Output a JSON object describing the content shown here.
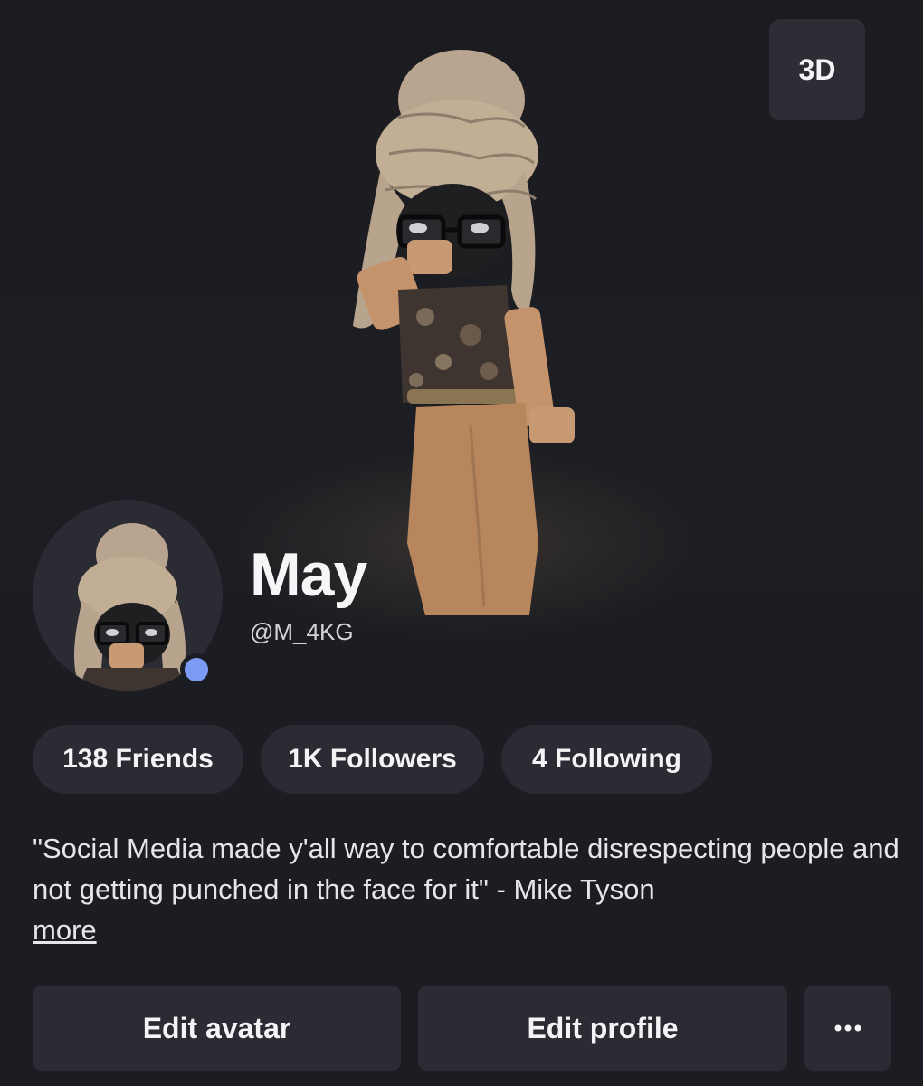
{
  "hero": {
    "view_toggle_label": "3D"
  },
  "profile": {
    "display_name": "May",
    "username": "@M_4KG",
    "status_color": "#7c9bf5"
  },
  "stats": [
    {
      "label": "138 Friends"
    },
    {
      "label": "1K Followers"
    },
    {
      "label": "4 Following"
    }
  ],
  "bio": {
    "text": "\"Social Media made y'all way to comfortable disrespecting people and not getting punched in the face for it\" - Mike Tyson",
    "more_label": "more"
  },
  "actions": {
    "edit_avatar": "Edit avatar",
    "edit_profile": "Edit profile",
    "more_icon": "ellipsis-icon"
  }
}
